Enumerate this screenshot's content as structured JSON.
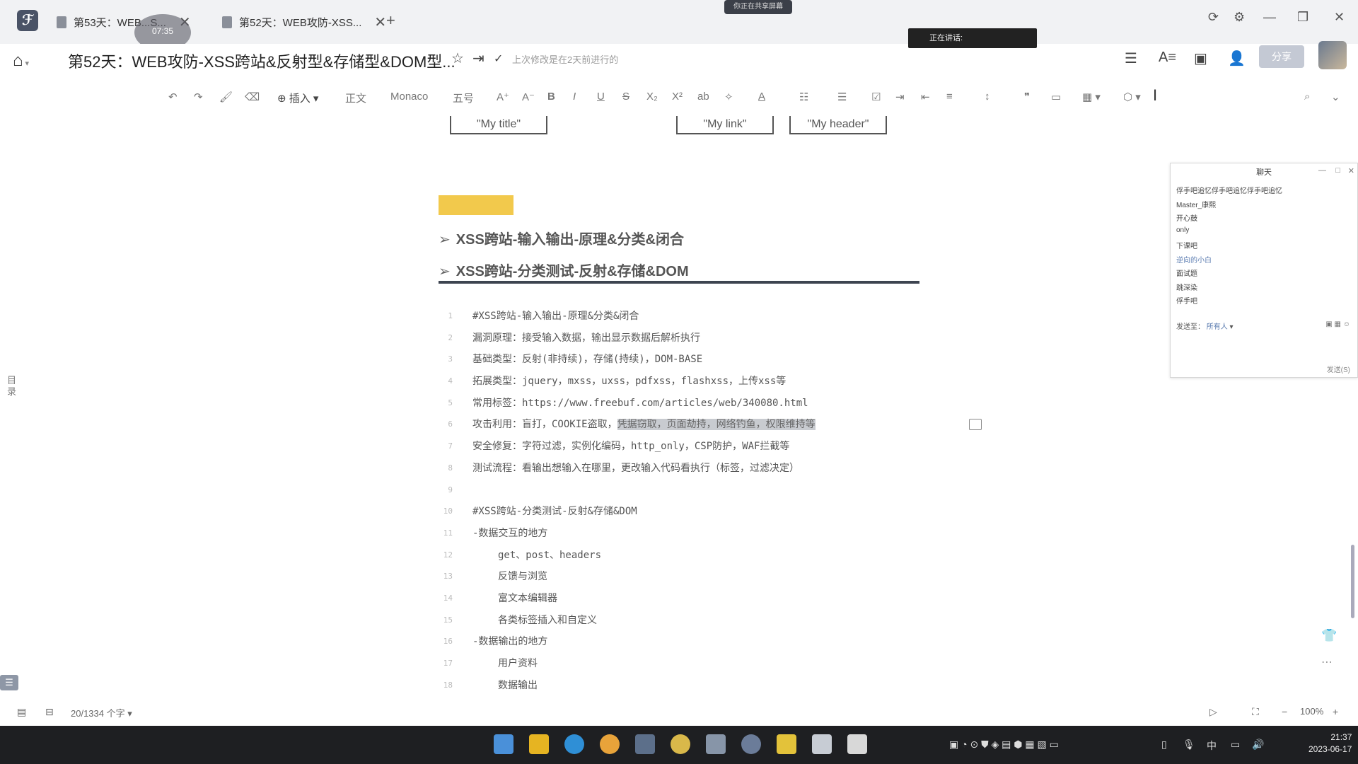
{
  "tabs": [
    {
      "label": "第53天：WEB...S...",
      "active": false
    },
    {
      "label": "第52天：WEB攻防-XSS...",
      "active": true
    }
  ],
  "recording_badge": "07:35",
  "share_pill": "你正在共享屏幕",
  "doc_title": "第52天：WEB攻防-XSS跨站&反射型&存储型&DOM型...",
  "saved_text": "上次修改是在2天前进行的",
  "speaking_text": "正在讲话:",
  "share_button": "分享",
  "toolbar": {
    "insert": "插入",
    "style": "正文",
    "font": "Monaco",
    "size": "五号"
  },
  "code_buttons": [
    "\"My title\"",
    "\"My link\"",
    "\"My header\""
  ],
  "headings": [
    "XSS跨站-输入输出-原理&分类&闭合",
    "XSS跨站-分类测试-反射&存储&DOM"
  ],
  "lines": [
    {
      "n": "1",
      "text": "#XSS跨站-输入输出-原理&分类&闭合",
      "indent": false
    },
    {
      "n": "2",
      "text": "漏洞原理：接受输入数据，输出显示数据后解析执行",
      "indent": false
    },
    {
      "n": "3",
      "text": "基础类型：反射(非持续)，存储(持续)，DOM-BASE",
      "indent": false
    },
    {
      "n": "4",
      "text": "拓展类型：jquery，mxss，uxss，pdfxss，flashxss，上传xss等",
      "indent": false
    },
    {
      "n": "5",
      "text": "常用标签：https://www.freebuf.com/articles/web/340080.html",
      "indent": false
    },
    {
      "n": "6",
      "text": "攻击利用：盲打，COOKIE盗取，",
      "selected": "凭据窃取，页面劫持，网络钓鱼，权限维持等",
      "indent": false
    },
    {
      "n": "7",
      "text": "安全修复：字符过滤，实例化编码，http_only，CSP防护，WAF拦截等",
      "indent": false
    },
    {
      "n": "8",
      "text": "测试流程：看输出想输入在哪里，更改输入代码看执行（标签，过滤决定）",
      "indent": false
    },
    {
      "n": "9",
      "text": "",
      "indent": false
    },
    {
      "n": "10",
      "text": "#XSS跨站-分类测试-反射&存储&DOM",
      "indent": false
    },
    {
      "n": "11",
      "text": "-数据交互的地方",
      "indent": false
    },
    {
      "n": "12",
      "text": "get、post、headers",
      "indent": true
    },
    {
      "n": "13",
      "text": "反馈与浏览",
      "indent": true
    },
    {
      "n": "14",
      "text": "富文本编辑器",
      "indent": true
    },
    {
      "n": "15",
      "text": "各类标签插入和自定义",
      "indent": true
    },
    {
      "n": "16",
      "text": "-数据输出的地方",
      "indent": false
    },
    {
      "n": "17",
      "text": "用户资料",
      "indent": true
    },
    {
      "n": "18",
      "text": "数据输出",
      "indent": true
    }
  ],
  "toc_label": "目录",
  "chat": {
    "title": "聊天",
    "messages": [
      "俘手吧追忆俘手吧追忆俘手吧追忆",
      "Master_康熙",
      "开心鼓",
      "only",
      "下课吧",
      "逆向的小白",
      "面试题",
      "跳深染",
      "俘手吧"
    ],
    "to_label": "发送至：",
    "to_value": "所有人",
    "send": "发送(S)"
  },
  "status": {
    "word_count": "20/1334 个字",
    "zoom": "100%"
  },
  "clock": {
    "time": "21:37",
    "date": "2023-06-17"
  },
  "tray_ime": "中"
}
